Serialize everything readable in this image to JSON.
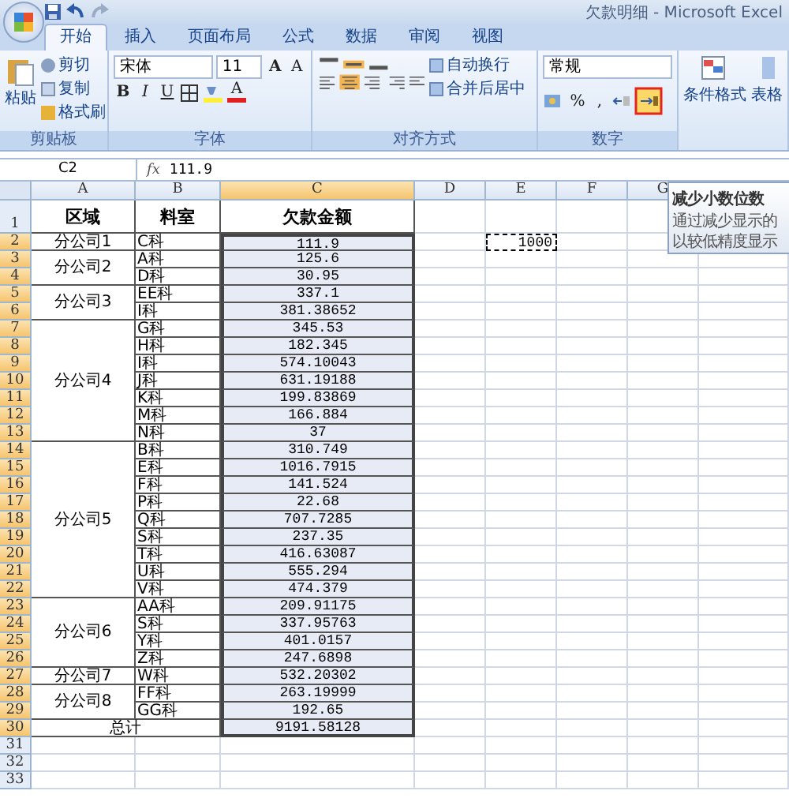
{
  "window": {
    "title": "欠款明细 - Microsoft Excel"
  },
  "tabs": [
    {
      "label": "开始",
      "selected": true
    },
    {
      "label": "插入",
      "selected": false
    },
    {
      "label": "页面布局",
      "selected": false
    },
    {
      "label": "公式",
      "selected": false
    },
    {
      "label": "数据",
      "selected": false
    },
    {
      "label": "审阅",
      "selected": false
    },
    {
      "label": "视图",
      "selected": false
    }
  ],
  "ribbon": {
    "clipboard": {
      "paste": "粘贴",
      "cut": "剪切",
      "copy": "复制",
      "painter": "格式刷",
      "label": "剪贴板"
    },
    "font": {
      "name": "宋体",
      "size": "11",
      "bold": "B",
      "italic": "I",
      "underline": "U",
      "grow": "A",
      "shrink": "A",
      "font_color_letter": "A",
      "label": "字体"
    },
    "alignment": {
      "wrap": "自动换行",
      "merge": "合并后居中",
      "label": "对齐方式"
    },
    "number": {
      "format": "常规",
      "percent": "%",
      "comma": ",",
      "label": "数字",
      "decrease_highlighted": true
    },
    "styles": {
      "conditional": "条件格式",
      "table": "表格"
    }
  },
  "tooltip": {
    "title": "减少小数位数",
    "lines": [
      "通过减少显示的",
      "以较低精度显示"
    ]
  },
  "formula_bar": {
    "name_box": "C2",
    "fx": "fx",
    "value": "111.9"
  },
  "sheet": {
    "columns": [
      {
        "label": "A",
        "selected": false
      },
      {
        "label": "B",
        "selected": false
      },
      {
        "label": "C",
        "selected": true
      },
      {
        "label": "D",
        "selected": false
      },
      {
        "label": "E",
        "selected": false
      },
      {
        "label": "F",
        "selected": false
      },
      {
        "label": "G",
        "selected": false
      }
    ],
    "row_numbers": [
      {
        "label": "1",
        "selected": false
      },
      {
        "label": "2",
        "selected": true
      },
      {
        "label": "3",
        "selected": true
      },
      {
        "label": "4",
        "selected": true
      },
      {
        "label": "5",
        "selected": true
      },
      {
        "label": "6",
        "selected": true
      },
      {
        "label": "7",
        "selected": true
      },
      {
        "label": "8",
        "selected": true
      },
      {
        "label": "9",
        "selected": true
      },
      {
        "label": "10",
        "selected": true
      },
      {
        "label": "11",
        "selected": true
      },
      {
        "label": "12",
        "selected": true
      },
      {
        "label": "13",
        "selected": true
      },
      {
        "label": "14",
        "selected": true
      },
      {
        "label": "15",
        "selected": true
      },
      {
        "label": "16",
        "selected": true
      },
      {
        "label": "17",
        "selected": true
      },
      {
        "label": "18",
        "selected": true
      },
      {
        "label": "19",
        "selected": true
      },
      {
        "label": "20",
        "selected": true
      },
      {
        "label": "21",
        "selected": true
      },
      {
        "label": "22",
        "selected": true
      },
      {
        "label": "23",
        "selected": true
      },
      {
        "label": "24",
        "selected": true
      },
      {
        "label": "25",
        "selected": true
      },
      {
        "label": "26",
        "selected": true
      },
      {
        "label": "27",
        "selected": true
      },
      {
        "label": "28",
        "selected": true
      },
      {
        "label": "29",
        "selected": true
      },
      {
        "label": "30",
        "selected": true
      },
      {
        "label": "31",
        "selected": false
      },
      {
        "label": "32",
        "selected": false
      },
      {
        "label": "33",
        "selected": false
      }
    ],
    "headers": [
      "区域",
      "料室",
      "欠款金额"
    ],
    "regions": [
      {
        "name": "分公司1",
        "rows": [
          {
            "dept": "C科",
            "amount": "111.9",
            "selected": true
          }
        ]
      },
      {
        "name": "分公司2",
        "rows": [
          {
            "dept": "A科",
            "amount": "125.6",
            "selected": true
          },
          {
            "dept": "D科",
            "amount": "30.95",
            "selected": true
          }
        ]
      },
      {
        "name": "分公司3",
        "rows": [
          {
            "dept": "EE科",
            "amount": "337.1",
            "selected": true
          },
          {
            "dept": "I科",
            "amount": "381.38652",
            "selected": true
          }
        ]
      },
      {
        "name": "分公司4",
        "rows": [
          {
            "dept": "G科",
            "amount": "345.53",
            "selected": true
          },
          {
            "dept": "H科",
            "amount": "182.345",
            "selected": true
          },
          {
            "dept": "I科",
            "amount": "574.10043",
            "selected": true
          },
          {
            "dept": "J科",
            "amount": "631.19188",
            "selected": true
          },
          {
            "dept": "K科",
            "amount": "199.83869",
            "selected": true
          },
          {
            "dept": "M科",
            "amount": "166.884",
            "selected": true
          },
          {
            "dept": "N科",
            "amount": "37",
            "selected": true
          }
        ]
      },
      {
        "name": "分公司5",
        "rows": [
          {
            "dept": "B科",
            "amount": "310.749",
            "selected": true
          },
          {
            "dept": "E科",
            "amount": "1016.7915",
            "selected": true
          },
          {
            "dept": "F科",
            "amount": "141.524",
            "selected": true
          },
          {
            "dept": "P科",
            "amount": "22.68",
            "selected": true
          },
          {
            "dept": "Q科",
            "amount": "707.7285",
            "selected": true
          },
          {
            "dept": "S科",
            "amount": "237.35",
            "selected": true
          },
          {
            "dept": "T科",
            "amount": "416.63087",
            "selected": true
          },
          {
            "dept": "U科",
            "amount": "555.294",
            "selected": true
          },
          {
            "dept": "V科",
            "amount": "474.379",
            "selected": true
          }
        ]
      },
      {
        "name": "分公司6",
        "rows": [
          {
            "dept": "AA科",
            "amount": "209.91175",
            "selected": true
          },
          {
            "dept": "S科",
            "amount": "337.95763",
            "selected": true
          },
          {
            "dept": "Y科",
            "amount": "401.0157",
            "selected": true
          },
          {
            "dept": "Z科",
            "amount": "247.6898",
            "selected": true
          }
        ]
      },
      {
        "name": "分公司7",
        "rows": [
          {
            "dept": "W科",
            "amount": "532.20302",
            "selected": true
          }
        ]
      },
      {
        "name": "分公司8",
        "rows": [
          {
            "dept": "FF科",
            "amount": "263.19999",
            "selected": true
          },
          {
            "dept": "GG科",
            "amount": "192.65",
            "selected": true
          }
        ]
      }
    ],
    "total": {
      "label": "总计",
      "amount": "9191.58128",
      "selected": true
    },
    "copied_cell": {
      "value": "1000",
      "copied": true
    }
  }
}
